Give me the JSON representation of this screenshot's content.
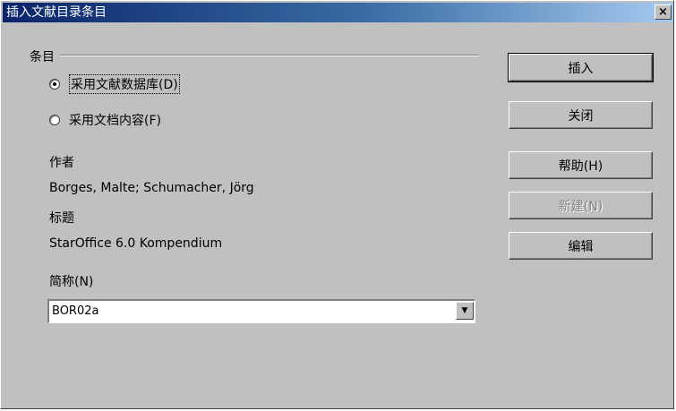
{
  "window": {
    "title": "插入文献目录条目",
    "close_label": "×"
  },
  "group": {
    "label": "条目"
  },
  "source_options": [
    {
      "label": "采用文献数据库(D)",
      "selected": true
    },
    {
      "label": "采用文档内容(F)",
      "selected": false
    }
  ],
  "fields": {
    "author_label": "作者",
    "author_value": "Borges, Malte; Schumacher, Jörg",
    "title_label": "标题",
    "title_value": "StarOffice 6.0 Kompendium",
    "short_name_label": "简称(N)",
    "short_name_value": "BOR02a",
    "dropdown_icon": "▼"
  },
  "buttons": {
    "insert": "插入",
    "close": "关闭",
    "help": "帮助(H)",
    "new": "新建(N)",
    "edit": "编辑"
  }
}
